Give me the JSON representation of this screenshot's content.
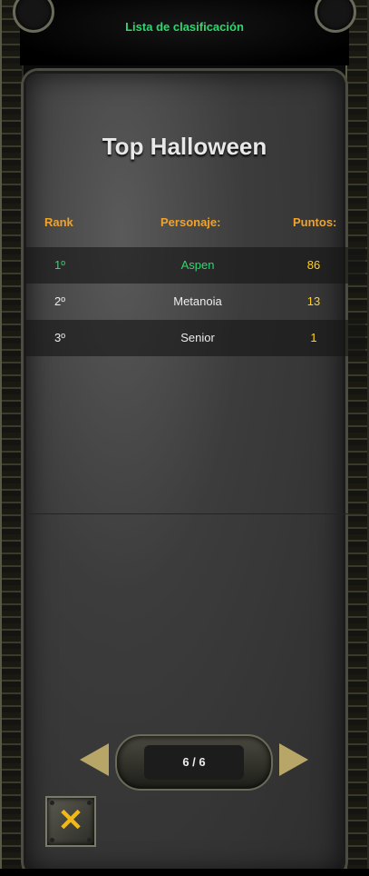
{
  "window": {
    "title": "Lista de clasificación"
  },
  "ranking": {
    "heading": "Top Halloween",
    "columns": {
      "rank": "Rank",
      "name": "Personaje:",
      "points": "Puntos:"
    },
    "rows": [
      {
        "rank": "1º",
        "name": "Aspen",
        "points": "86"
      },
      {
        "rank": "2º",
        "name": "Metanoia",
        "points": "13"
      },
      {
        "rank": "3º",
        "name": "Senior",
        "points": "1"
      }
    ]
  },
  "pager": {
    "text": "6 / 6"
  },
  "colors": {
    "title": "#2bd96d",
    "header": "#f0a32a",
    "points": "#ffd11a",
    "highlight_name": "#2bd96d"
  }
}
